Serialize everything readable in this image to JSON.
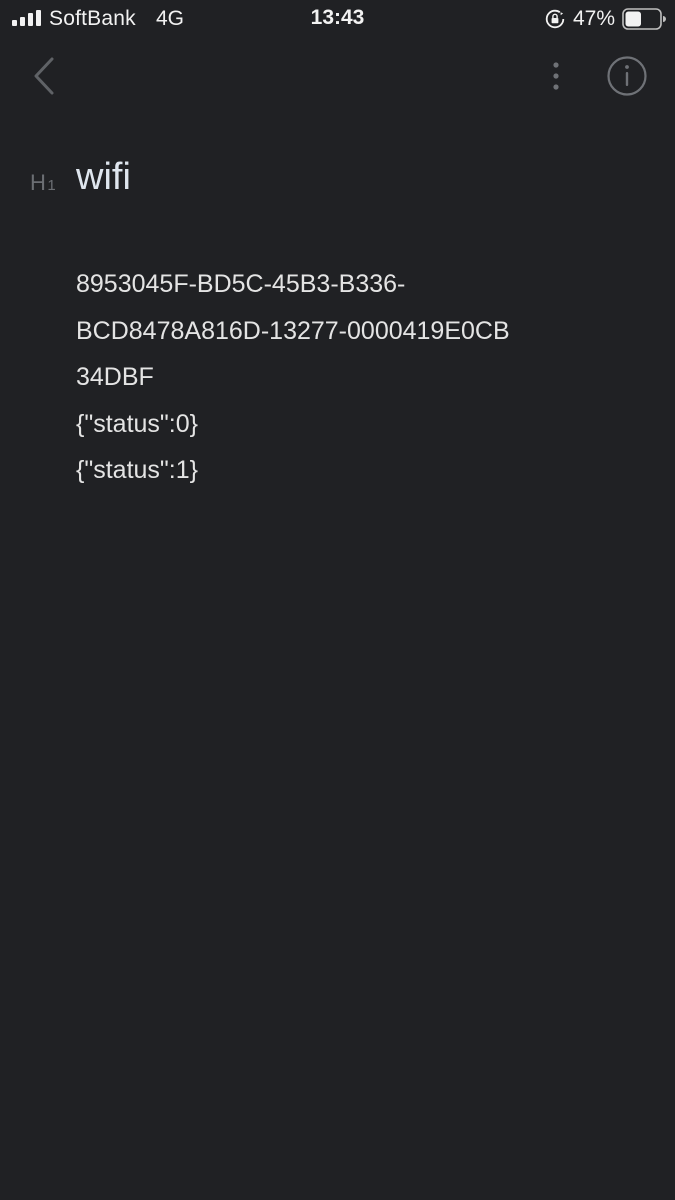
{
  "status_bar": {
    "carrier": "SoftBank",
    "network": "4G",
    "time": "13:43",
    "battery_percent": "47%",
    "battery_level": 0.47,
    "icons": [
      "signal-icon",
      "rotation-lock-icon",
      "battery-icon"
    ]
  },
  "nav": {
    "icons": [
      "back-chevron-icon",
      "more-vertical-icon",
      "info-icon"
    ]
  },
  "note": {
    "heading_marker": "H",
    "heading_marker_level": "1",
    "heading": "wifi",
    "lines": [
      "8953045F-BD5C-45B3-B336-",
      "BCD8478A816D-13277-0000419E0CB",
      "34DBF",
      "{\"status\":0}",
      "{\"status\":1}"
    ]
  },
  "colors": {
    "background": "#202124",
    "text": "#e4e4e4",
    "heading": "#dfe6ee",
    "muted": "#6b6e73"
  }
}
